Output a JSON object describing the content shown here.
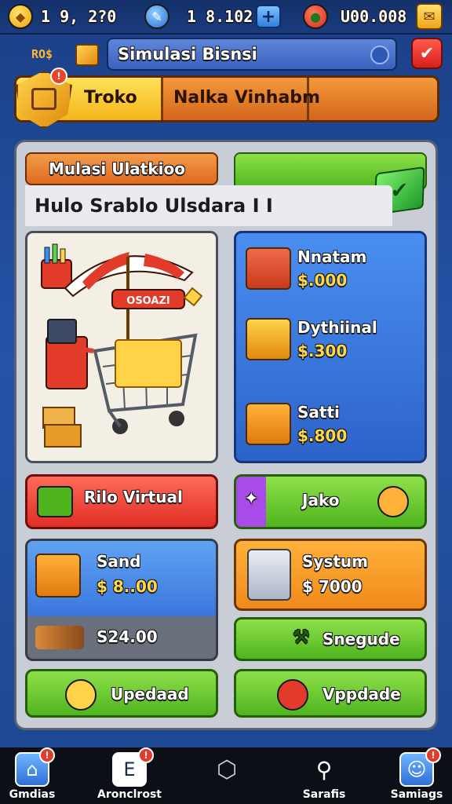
{
  "resources": {
    "coins": "1 9, 2?0",
    "gems": "1 8.102",
    "fruit": "U00.008"
  },
  "header": {
    "tag": "RO$",
    "title": "Simulasi Bisnsi"
  },
  "tabs": [
    {
      "label": "Troko"
    },
    {
      "label": "Nalka Vinhabm"
    },
    {
      "label": ""
    }
  ],
  "shop": {
    "top_button": "Mulasi Ulatkioo",
    "heading": "Hulo Srablo Ulsdara I I",
    "illustration_sign": "OSOAZI",
    "items": [
      {
        "name": "Nnatam",
        "price": "$.000"
      },
      {
        "name": "Dythiinal",
        "price": "$.300"
      },
      {
        "name": "Satti",
        "price": "$.800"
      }
    ]
  },
  "actions": {
    "rilo_virtual": "Rilo Virtual",
    "jako": "Jako",
    "sand_name": "Sand",
    "sand_price": "$ 8..00",
    "sand_footer": "S24.00",
    "system_name": "Systum",
    "system_price": "$ 7000",
    "snegude": "Snegude",
    "upedaad": "Upedaad",
    "vppdade": "Vppdade"
  },
  "bottom_nav": [
    {
      "label": "Gmdias",
      "badge": "!"
    },
    {
      "label": "Aronclrost",
      "badge": "!"
    },
    {
      "label": ""
    },
    {
      "label": "Sarafis"
    },
    {
      "label": "Samiags",
      "badge": "!"
    }
  ],
  "colors": {
    "background": "#2453a8",
    "accent_green": "#4fb51e",
    "accent_orange": "#de6b1e",
    "accent_red": "#e02d25",
    "gold": "#ffd84a"
  }
}
